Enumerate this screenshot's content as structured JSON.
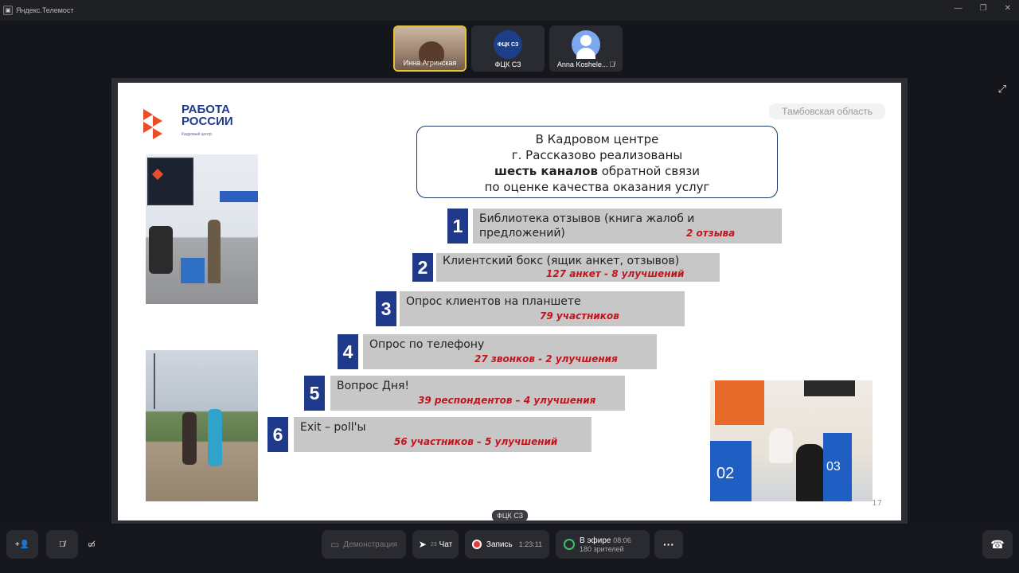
{
  "window": {
    "title": "Яндекс.Телемост",
    "app_icon": "telemost-icon"
  },
  "participants": [
    {
      "name": "Инна Агринская",
      "active": true
    },
    {
      "name": "ФЦК СЗ",
      "avatar_text": "ФЦК СЗ"
    },
    {
      "name": "Anna Koshele...",
      "muted": true
    }
  ],
  "slide": {
    "logo_line1": "РАБОТА",
    "logo_line2": "РОССИИ",
    "logo_sub": "Кадровый центр",
    "region": "Тамбовская область",
    "headline": {
      "line1": "В Кадровом центре",
      "line2": "г. Рассказово реализованы",
      "bold": "шесть каналов",
      "line3_rest": " обратной связи",
      "line4": "по оценке качества оказания услуг"
    },
    "channels": [
      {
        "num": "1",
        "label": "Библиотека отзывов (книга жалоб и предложений)",
        "stat": "2 отзыва"
      },
      {
        "num": "2",
        "label": "Клиентский бокс (ящик анкет, отзывов)",
        "stat": "127 анкет - 8 улучшений"
      },
      {
        "num": "3",
        "label": "Опрос клиентов на планшете",
        "stat": "79 участников"
      },
      {
        "num": "4",
        "label": "Опрос по телефону",
        "stat": "27 звонков - 2 улучшения"
      },
      {
        "num": "5",
        "label": "Вопрос  Дня!",
        "stat": "39 респондентов – 4 улучшения"
      },
      {
        "num": "6",
        "label": "Exit – poll'ы",
        "stat": "56 участников – 5 улучшений"
      }
    ],
    "photo3_num_a": "02",
    "photo3_num_b": "03",
    "slide_number": "17"
  },
  "presenter_tag": "ФЦК СЗ",
  "controls": {
    "share_label": "Демонстрация",
    "chat_label": "Чат",
    "chat_badge": "23",
    "record_label": "Запись",
    "record_time": "1:23:11",
    "live_label": "В эфире",
    "live_time": "08:06",
    "viewers": "180 зрителей",
    "more": "···"
  },
  "colors": {
    "brand_blue": "#1f3a8a",
    "brand_orange": "#e84e2b",
    "stat_red": "#c0151d",
    "active_border": "#e7c331"
  }
}
